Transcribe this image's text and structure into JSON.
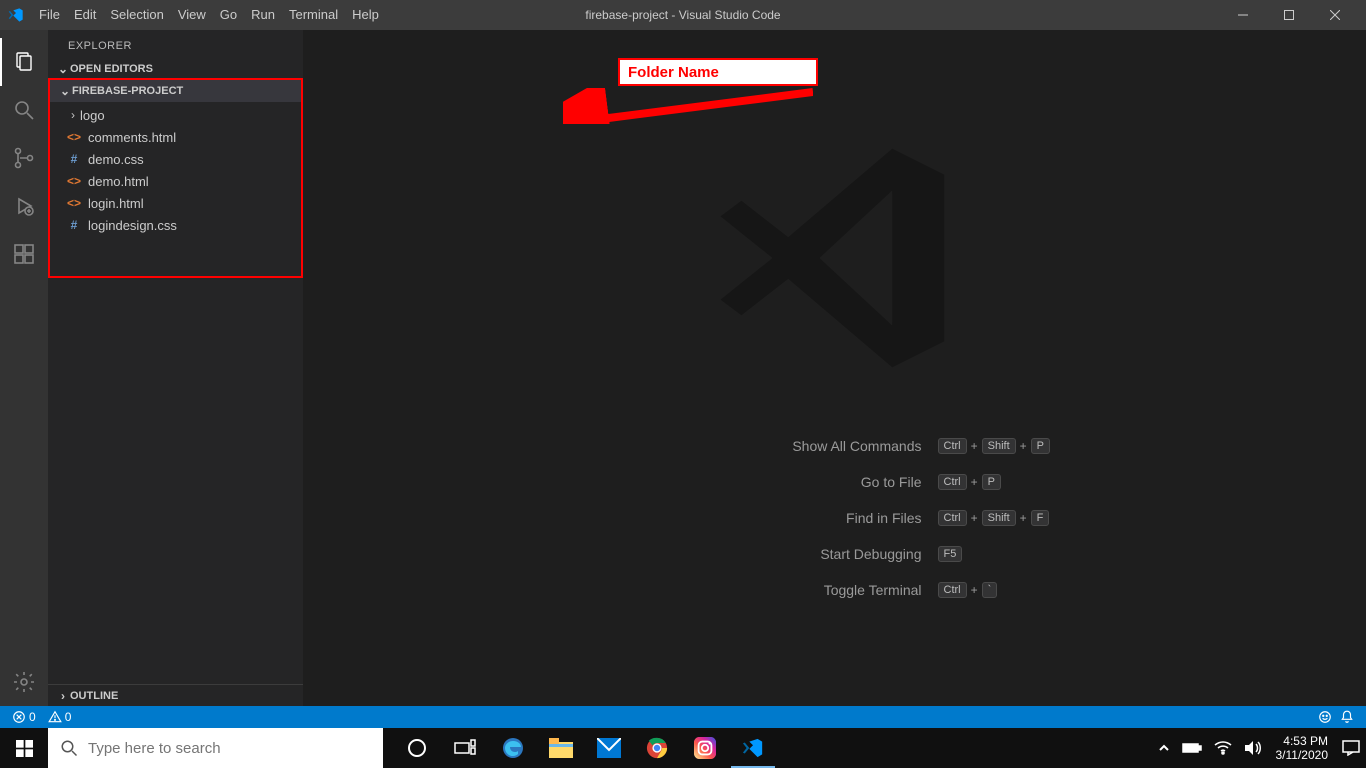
{
  "title": "firebase-project - Visual Studio Code",
  "menu": [
    "File",
    "Edit",
    "Selection",
    "View",
    "Go",
    "Run",
    "Terminal",
    "Help"
  ],
  "sidebar": {
    "header": "EXPLORER",
    "open_editors": "OPEN EDITORS",
    "project_name": "FIREBASE-PROJECT",
    "outline": "OUTLINE",
    "files": [
      {
        "name": "logo",
        "type": "folder"
      },
      {
        "name": "comments.html",
        "type": "html"
      },
      {
        "name": "demo.css",
        "type": "css"
      },
      {
        "name": "demo.html",
        "type": "html"
      },
      {
        "name": "login.html",
        "type": "html"
      },
      {
        "name": "logindesign.css",
        "type": "css"
      }
    ]
  },
  "annotation": {
    "label": "Folder Name"
  },
  "shortcuts": [
    {
      "label": "Show All Commands",
      "keys": [
        "Ctrl",
        "Shift",
        "P"
      ]
    },
    {
      "label": "Go to File",
      "keys": [
        "Ctrl",
        "P"
      ]
    },
    {
      "label": "Find in Files",
      "keys": [
        "Ctrl",
        "Shift",
        "F"
      ]
    },
    {
      "label": "Start Debugging",
      "keys": [
        "F5"
      ]
    },
    {
      "label": "Toggle Terminal",
      "keys": [
        "Ctrl",
        "`"
      ]
    }
  ],
  "status": {
    "errors": "0",
    "warnings": "0"
  },
  "taskbar": {
    "search_placeholder": "Type here to search",
    "time": "4:53 PM",
    "date": "3/11/2020"
  }
}
